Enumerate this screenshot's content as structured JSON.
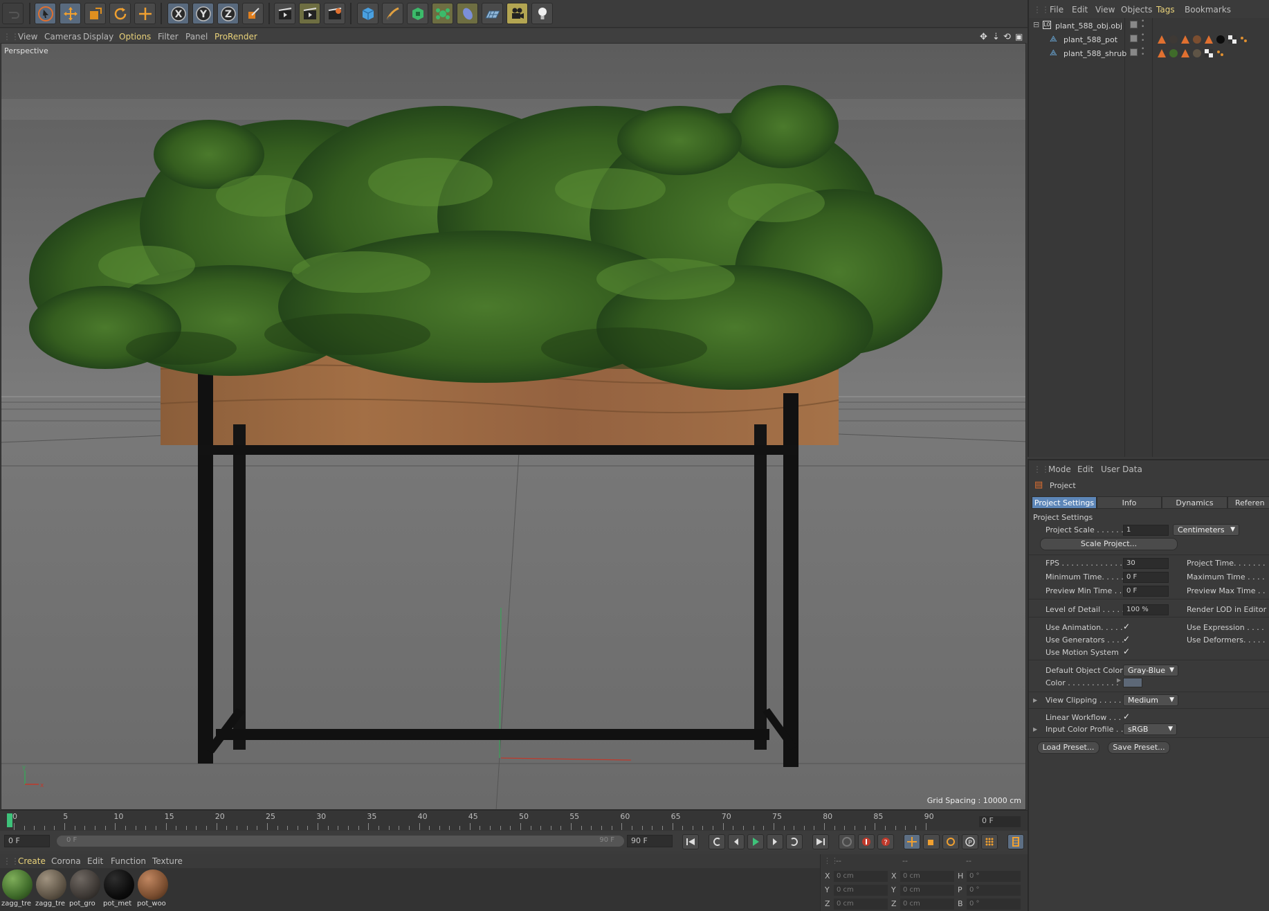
{
  "toolbar": {
    "axis_x": "X",
    "axis_y": "Y",
    "axis_z": "Z"
  },
  "viewport": {
    "menu": [
      "View",
      "Cameras",
      "Display",
      "Options",
      "Filter",
      "Panel",
      "ProRender"
    ],
    "label": "Perspective",
    "grid_spacing": "Grid Spacing : 10000 cm",
    "axis_y": "y",
    "axis_x": "x"
  },
  "timeline": {
    "ticks": [
      "0",
      "5",
      "10",
      "15",
      "20",
      "25",
      "30",
      "35",
      "40",
      "45",
      "50",
      "55",
      "60",
      "65",
      "70",
      "75",
      "80",
      "85",
      "90"
    ],
    "current_frame_display": "0 F",
    "start_field": "0 F",
    "range_start": "0 F",
    "range_end": "90 F",
    "end_field": "90 F"
  },
  "material_manager": {
    "menu": [
      "Create",
      "Corona",
      "Edit",
      "Function",
      "Texture"
    ],
    "materials": [
      {
        "label": "zagg_tre",
        "color": "#3f6b2a"
      },
      {
        "label": "zagg_tre",
        "color": "#5e5446"
      },
      {
        "label": "pot_gro",
        "color": "#3e3935"
      },
      {
        "label": "pot_met",
        "color": "#0c0c0c"
      },
      {
        "label": "pot_woo",
        "color": "#7b4e30"
      }
    ]
  },
  "coordinates": {
    "header_dashes": [
      "--",
      "--",
      "--"
    ],
    "rows": [
      {
        "a": "X",
        "av": "0 cm",
        "b": "X",
        "bv": "0 cm",
        "c": "H",
        "cv": "0 °"
      },
      {
        "a": "Y",
        "av": "0 cm",
        "b": "Y",
        "bv": "0 cm",
        "c": "P",
        "cv": "0 °"
      },
      {
        "a": "Z",
        "av": "0 cm",
        "b": "Z",
        "bv": "0 cm",
        "c": "B",
        "cv": "0 °"
      }
    ]
  },
  "object_manager": {
    "menu": [
      "File",
      "Edit",
      "View",
      "Objects",
      "Tags",
      "Bookmarks"
    ],
    "objects": [
      {
        "name": "plant_588_obj.obj"
      },
      {
        "name": "plant_588_pot"
      },
      {
        "name": "plant_588_shrub"
      }
    ]
  },
  "attributes": {
    "menu": [
      "Mode",
      "Edit",
      "User Data"
    ],
    "title": "Project",
    "tabs": [
      "Project Settings",
      "Info",
      "Dynamics",
      "Referen"
    ],
    "section": "Project Settings",
    "project_scale_label": "Project Scale . . . . . .",
    "project_scale_value": "1",
    "project_scale_unit": "Centimeters",
    "scale_project_button": "Scale Project...",
    "fps_label": "FPS . . . . . . . . . . . . . .",
    "fps_value": "30",
    "min_time_label": "Minimum Time. . . . .",
    "min_time_value": "0 F",
    "preview_min_label": "Preview Min Time . .",
    "preview_min_value": "0 F",
    "project_time_label": "Project Time. . . . . . .",
    "max_time_label": "Maximum Time . . . .",
    "preview_max_label": "Preview Max Time . .",
    "lod_label": "Level of Detail . . . . .",
    "lod_value": "100 %",
    "render_lod_label": "Render LOD in Editor",
    "use_animation_label": "Use Animation. . . . .",
    "use_generators_label": "Use Generators . . . .",
    "use_motion_label": "Use Motion System",
    "use_expression_label": "Use Expression . . . .",
    "use_deformers_label": "Use Deformers. . . . .",
    "default_color_label": "Default Object Color",
    "default_color_value": "Gray-Blue",
    "color_label": "Color . . . . . . . . . . .",
    "color_swatch": "#5d6877",
    "view_clipping_label": "View Clipping . . . . .",
    "view_clipping_value": "Medium",
    "linear_workflow_label": "Linear Workflow . . .",
    "input_color_label": "Input Color Profile . .",
    "input_color_value": "sRGB",
    "load_preset": "Load Preset...",
    "save_preset": "Save Preset..."
  }
}
